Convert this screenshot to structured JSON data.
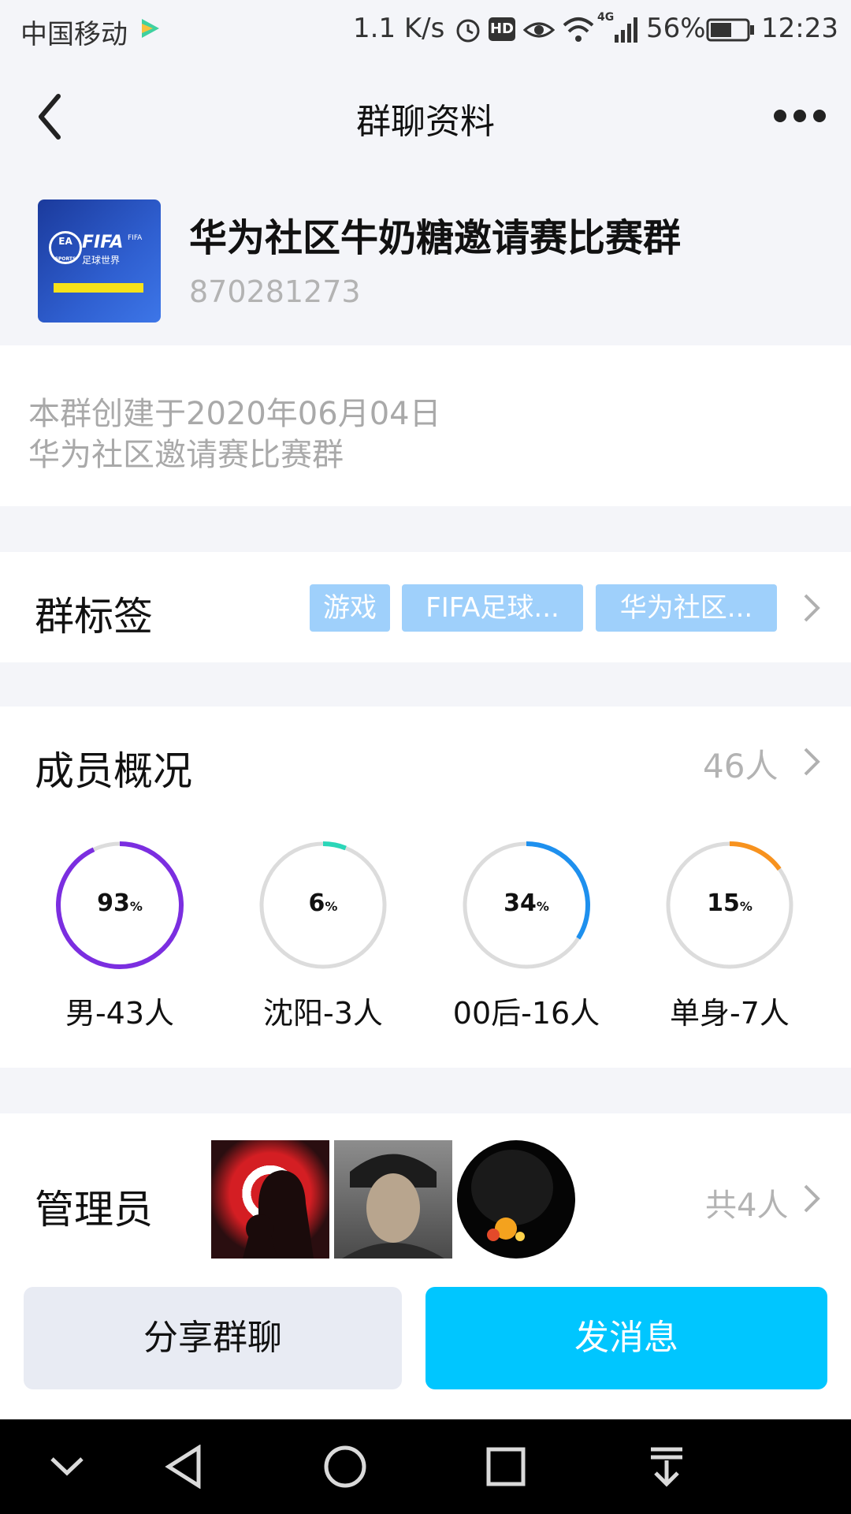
{
  "status_bar": {
    "carrier": "中国移动",
    "speed": "1.1 K/s",
    "hd": "HD",
    "network": "4G",
    "battery": "56%",
    "time": "12:23"
  },
  "nav": {
    "title": "群聊资料",
    "back_icon": "chevron-left-icon",
    "more_icon": "more-dots-icon"
  },
  "group": {
    "avatar_text_1": "FIFA",
    "avatar_text_2": "足球世界",
    "avatar_text_3": "FIFA",
    "avatar_text_4": "EA",
    "avatar_text_5": "SPORTS",
    "name": "华为社区牛奶糖邀请赛比赛群",
    "id": "870281273",
    "desc_line1": "本群创建于2020年06月04日",
    "desc_line2": "华为社区邀请赛比赛群"
  },
  "tags": {
    "label": "群标签",
    "items": [
      "游戏",
      "FIFA足球...",
      "华为社区..."
    ]
  },
  "members": {
    "label": "成员概况",
    "count": "46人",
    "stats": [
      {
        "value": "93",
        "pct": "%",
        "caption": "男-43人",
        "fraction": 0.93,
        "color": "#7b2ee0"
      },
      {
        "value": "6",
        "pct": "%",
        "caption": "沈阳-3人",
        "fraction": 0.06,
        "color": "#2bd6b8"
      },
      {
        "value": "34",
        "pct": "%",
        "caption": "00后-16人",
        "fraction": 0.34,
        "color": "#1e90ee"
      },
      {
        "value": "15",
        "pct": "%",
        "caption": "单身-7人",
        "fraction": 0.15,
        "color": "#f7921e"
      }
    ]
  },
  "admins": {
    "label": "管理员",
    "count": "共4人"
  },
  "buttons": {
    "share": "分享群聊",
    "send": "发消息"
  },
  "colors": {
    "accent": "#00c6ff",
    "tag_bg": "#9fd0fb",
    "share_bg": "#e8ebf3"
  }
}
